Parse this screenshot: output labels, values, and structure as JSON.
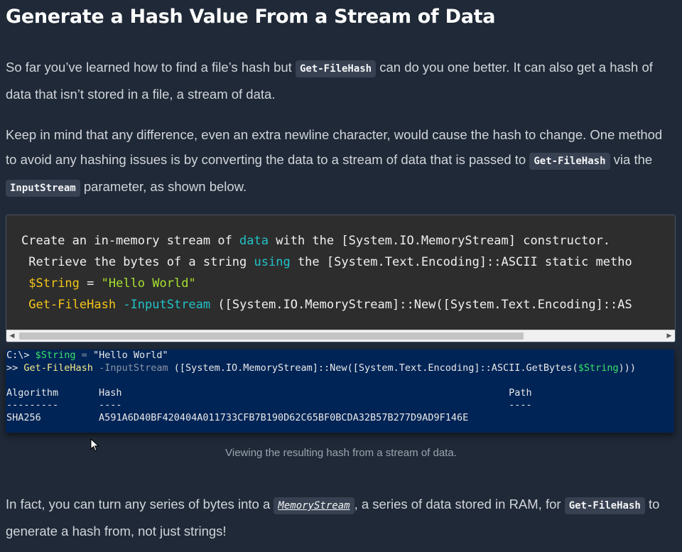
{
  "heading": "Generate a Hash Value From a Stream of Data",
  "para1": {
    "before": "So far you’ve learned how to find a file’s hash but ",
    "code": "Get-FileHash",
    "after": " can do you one better. It can also get a hash of data that isn’t stored in a file, a stream of data."
  },
  "para2": {
    "before": "Keep in mind that any difference, even an extra newline character, would cause the hash to change. One method to avoid any hashing issues is by converting the data to a stream of data that is passed to ",
    "code1": "Get-FileHash",
    "middle": " via the ",
    "code2": "InputStream",
    "after": " parameter, as shown below."
  },
  "code_block": {
    "line1": {
      "a": "Create an in-memory stream of ",
      "kw1": "data",
      "b": " with the [System.IO.MemoryStream] constructor."
    },
    "line2": {
      "a": " Retrieve the bytes of a string ",
      "kw": "using",
      "b": " the [System.Text.Encoding]::ASCII static metho"
    },
    "line3": {
      "var": "$String",
      "eq": " = ",
      "str": "\"Hello World\""
    },
    "line4": {
      "cmd": "Get-FileHash",
      "param": " -InputStream",
      "b": " ([System.IO.MemoryStream]::New([System.Text.Encoding]::AS"
    }
  },
  "terminal": {
    "prompt1": "C:\\> ",
    "var1": "$String",
    "eq1": " = ",
    "str1": "\"Hello World\"",
    "prompt2": ">> ",
    "cmd": "Get-FileHash",
    "param": " -InputStream",
    "expr_a": " ([System.IO.MemoryStream]::New([System.Text.Encoding]::ASCII.GetBytes(",
    "var2": "$String",
    "expr_b": ")))",
    "header": "Algorithm       Hash                                                                   Path",
    "underline": "---------       ----                                                                   ----",
    "algorithm": "SHA256",
    "hash_row": "          A591A6D40BF420404A011733CFB7B190D62C65BF0BCDA32B57B277D9AD9F146E"
  },
  "caption": "Viewing the resulting hash from a stream of data.",
  "para3": {
    "before": "In fact, you can turn any series of bytes into a ",
    "link": "MemoryStream",
    "middle": ", a series of data stored in RAM, for ",
    "code": "Get-FileHash",
    "after": " to generate a hash from, not just strings!"
  },
  "colors": {
    "background": "#1f2937",
    "code_bg": "#2d2d2d",
    "terminal_bg": "#012456",
    "keyword": "#22c2c8",
    "variable": "#f5c518",
    "string": "#a6e22e"
  }
}
